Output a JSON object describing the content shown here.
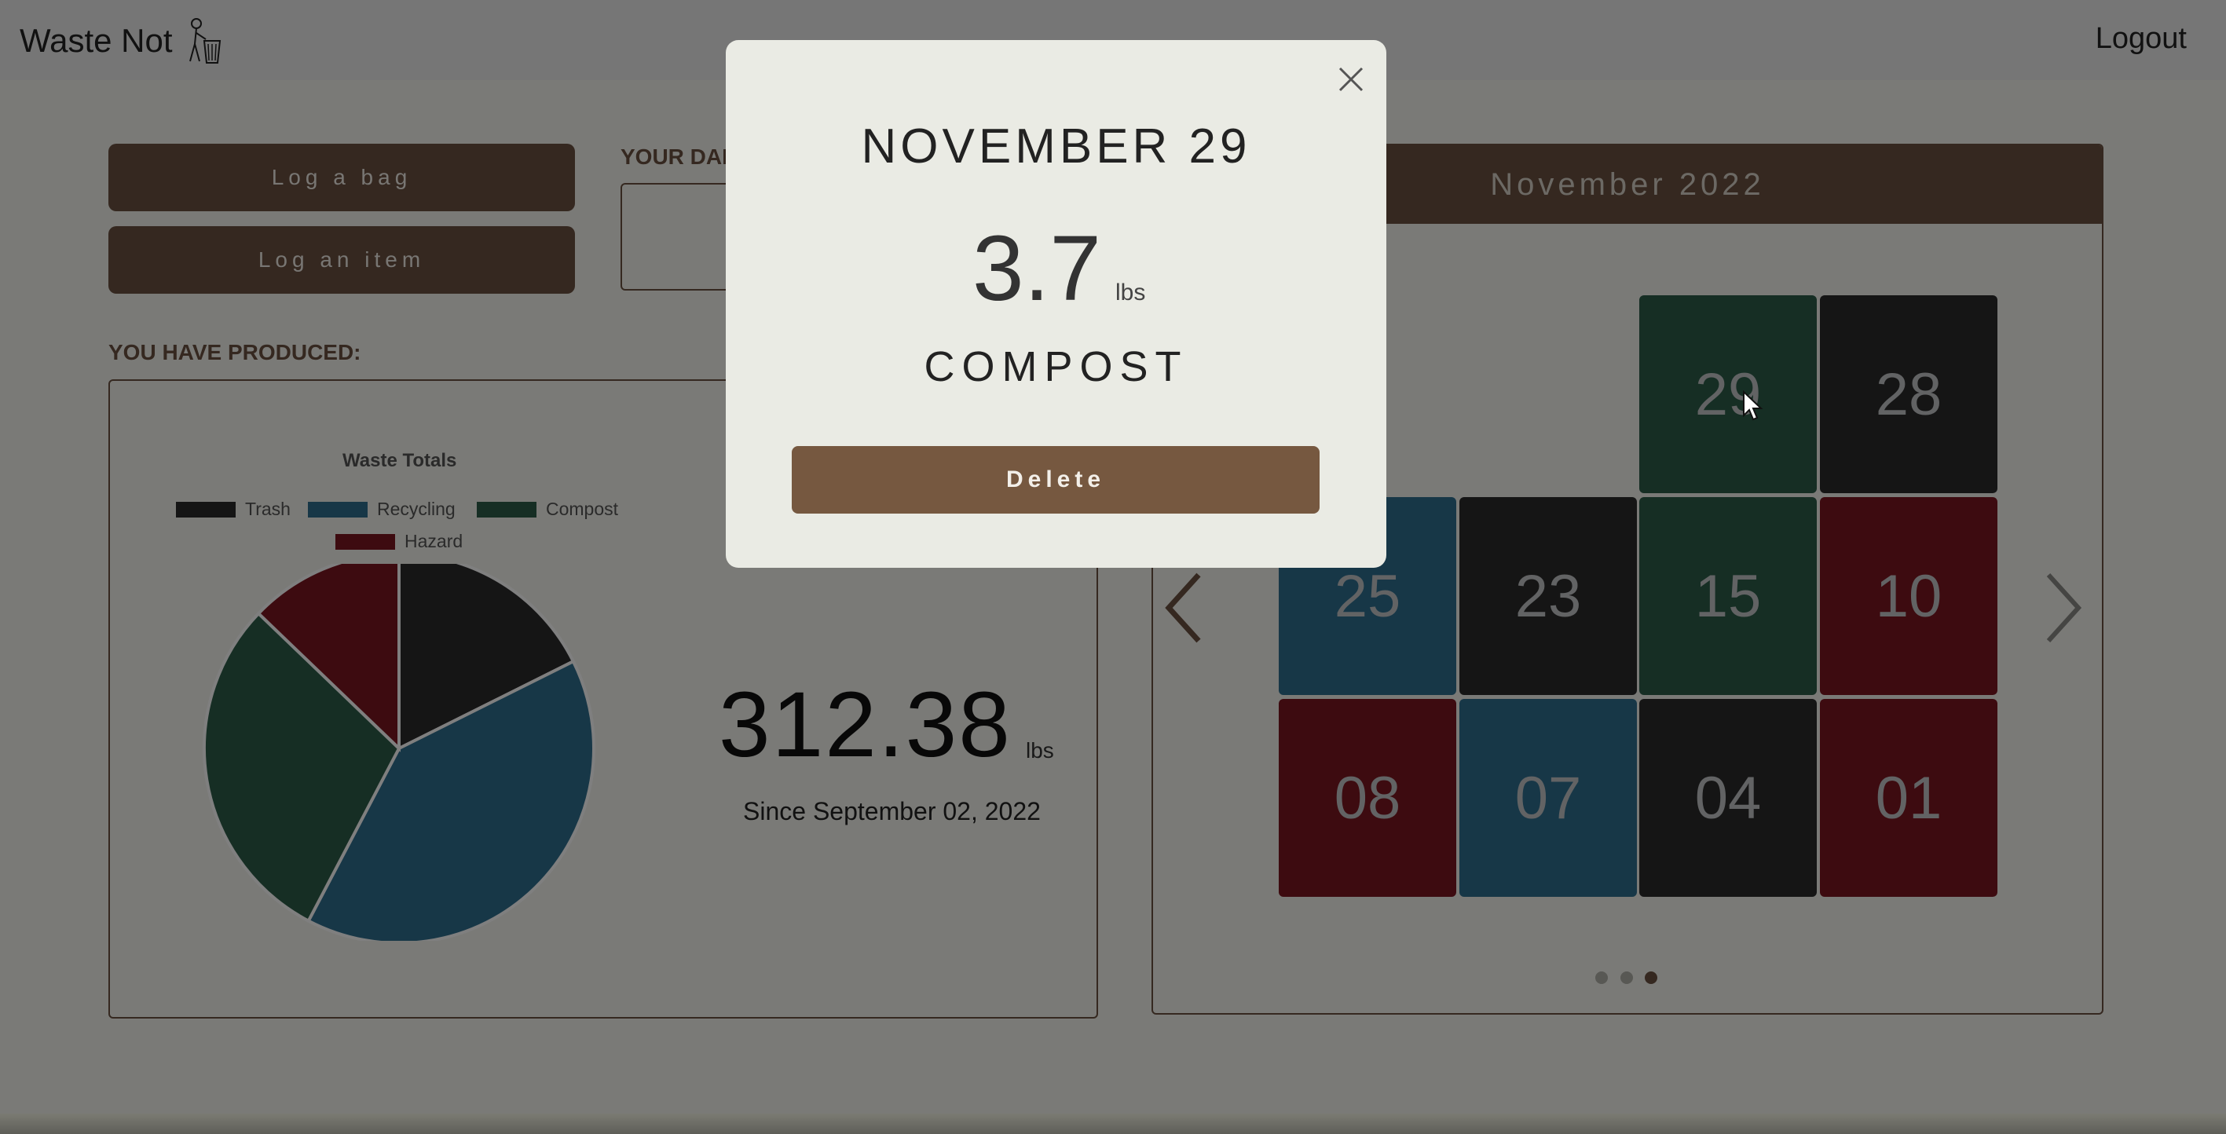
{
  "navbar": {
    "brand": "Waste Not",
    "logout": "Logout"
  },
  "actions": {
    "log_bag": "Log a bag",
    "log_item": "Log an item"
  },
  "daily": {
    "label": "YOUR DAI"
  },
  "produced": {
    "label": "YOU HAVE PRODUCED:",
    "total": "312.38",
    "unit": "lbs",
    "since": "Since September 02, 2022"
  },
  "chart_data": {
    "type": "pie",
    "title": "Waste Totals",
    "series": [
      {
        "name": "Trash",
        "value": 55,
        "color": "#2a2a2a"
      },
      {
        "name": "Recycling",
        "value": 125,
        "color": "#2e6e8f"
      },
      {
        "name": "Compost",
        "value": 92,
        "color": "#2d5c49"
      },
      {
        "name": "Hazard",
        "value": 40,
        "color": "#7a1620"
      }
    ],
    "legend_position": "top"
  },
  "calendar": {
    "month": "November 2022",
    "tiles": [
      {
        "day": "29",
        "category": "Compost",
        "color": "#2d5c49"
      },
      {
        "day": "28",
        "category": "Trash",
        "color": "#2a2a2a"
      },
      {
        "day": "25",
        "category": "Recycling",
        "color": "#2e6e8f"
      },
      {
        "day": "23",
        "category": "Trash",
        "color": "#2a2a2a"
      },
      {
        "day": "15",
        "category": "Compost",
        "color": "#2d5c49"
      },
      {
        "day": "10",
        "category": "Hazard",
        "color": "#7a1620"
      },
      {
        "day": "08",
        "category": "Hazard",
        "color": "#7a1620"
      },
      {
        "day": "07",
        "category": "Recycling",
        "color": "#2e6e8f"
      },
      {
        "day": "04",
        "category": "Trash",
        "color": "#2a2a2a"
      },
      {
        "day": "01",
        "category": "Hazard",
        "color": "#7a1620"
      }
    ],
    "page_indicator": {
      "pages": 3,
      "active": 3
    }
  },
  "modal": {
    "date": "NOVEMBER 29",
    "weight": "3.7",
    "unit": "lbs",
    "type": "COMPOST",
    "delete_label": "Delete"
  },
  "colors": {
    "brand_brown": "#6b5140",
    "button_brown": "#765840"
  }
}
